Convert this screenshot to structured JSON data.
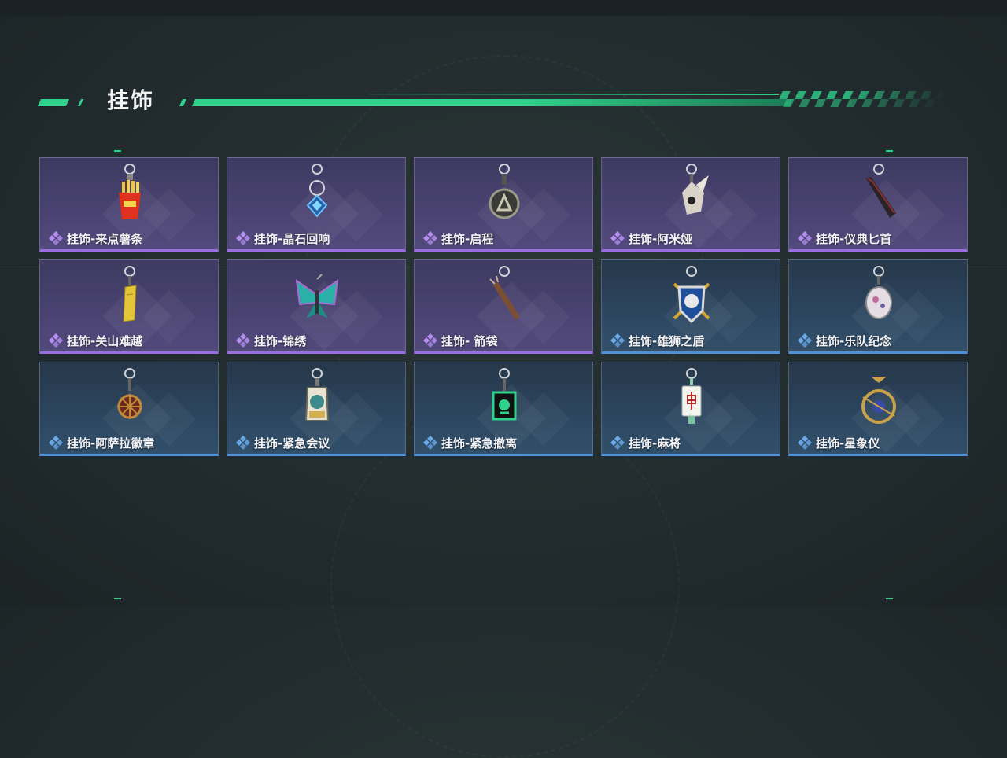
{
  "section": {
    "title": "挂饰"
  },
  "colors": {
    "accent": "#2fd18c",
    "purple_rarity": "#9a6ee0",
    "blue_rarity": "#4f90d6"
  },
  "items": [
    {
      "name": "挂饰-来点薯条",
      "rarity": "purple",
      "icon": "fries-charm-icon"
    },
    {
      "name": "挂饰-晶石回响",
      "rarity": "purple",
      "icon": "crystal-charm-icon"
    },
    {
      "name": "挂饰-启程",
      "rarity": "purple",
      "icon": "ring-emblem-charm-icon"
    },
    {
      "name": "挂饰-阿米娅",
      "rarity": "purple",
      "icon": "amiya-charm-icon"
    },
    {
      "name": "挂饰-仪典匕首",
      "rarity": "purple",
      "icon": "dagger-charm-icon"
    },
    {
      "name": "挂饰-关山难越",
      "rarity": "purple",
      "icon": "gold-bar-charm-icon"
    },
    {
      "name": "挂饰-锦绣",
      "rarity": "purple",
      "icon": "butterfly-charm-icon"
    },
    {
      "name": "挂饰- 箭袋",
      "rarity": "purple",
      "icon": "quiver-charm-icon"
    },
    {
      "name": "挂饰-雄狮之盾",
      "rarity": "blue",
      "icon": "lion-shield-charm-icon"
    },
    {
      "name": "挂饰-乐队纪念",
      "rarity": "blue",
      "icon": "band-badge-charm-icon"
    },
    {
      "name": "挂饰-阿萨拉徽章",
      "rarity": "blue",
      "icon": "wheel-badge-charm-icon"
    },
    {
      "name": "挂饰-紧急会议",
      "rarity": "blue",
      "icon": "meeting-charm-icon"
    },
    {
      "name": "挂饰-紧急撤离",
      "rarity": "blue",
      "icon": "evacuation-charm-icon"
    },
    {
      "name": "挂饰-麻将",
      "rarity": "blue",
      "icon": "mahjong-tile-charm-icon"
    },
    {
      "name": "挂饰-星象仪",
      "rarity": "blue",
      "icon": "astrolabe-charm-icon"
    }
  ]
}
